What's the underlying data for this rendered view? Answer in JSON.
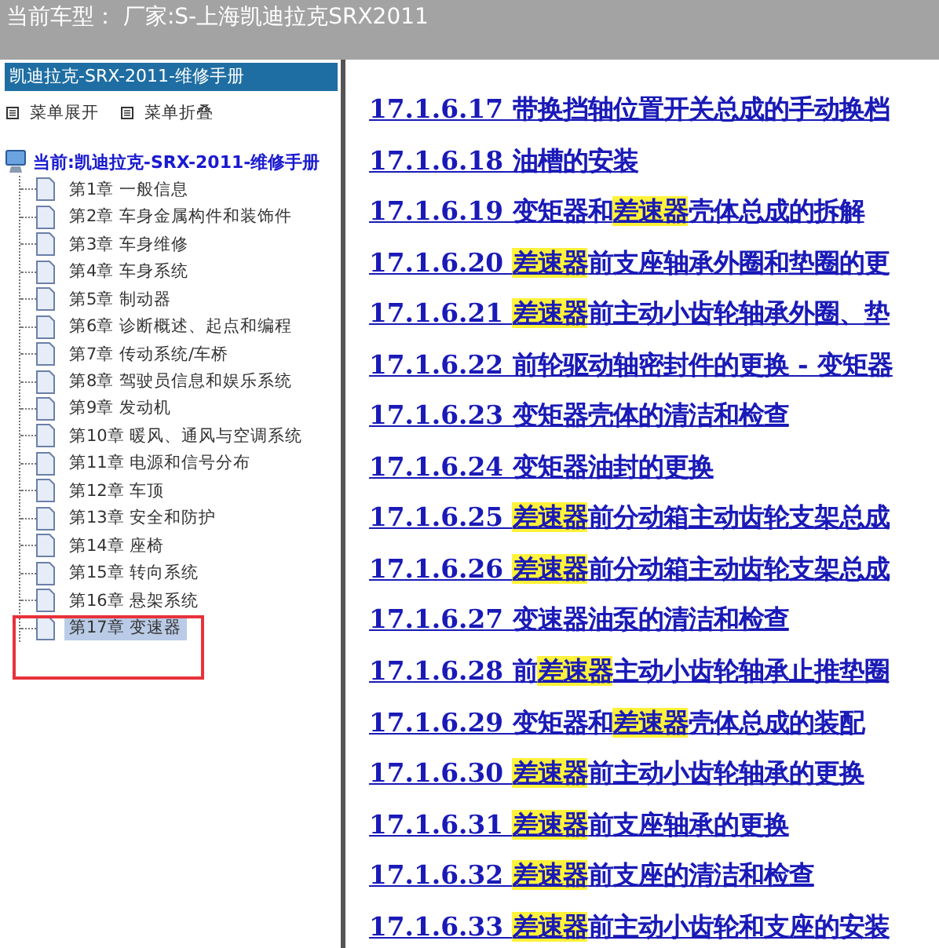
{
  "top_bar": {
    "title": "当前车型： 厂家:S-上海凯迪拉克SRX2011"
  },
  "sidebar": {
    "header": "凯迪拉克-SRX-2011-维修手册",
    "menu": [
      {
        "label": "菜单展开"
      },
      {
        "label": "菜单折叠"
      }
    ],
    "root": "当前:凯迪拉克-SRX-2011-维修手册",
    "items": [
      {
        "label": "第1章 一般信息",
        "selected": false
      },
      {
        "label": "第2章 车身金属构件和装饰件",
        "selected": false
      },
      {
        "label": "第3章 车身维修",
        "selected": false
      },
      {
        "label": "第4章 车身系统",
        "selected": false
      },
      {
        "label": "第5章 制动器",
        "selected": false
      },
      {
        "label": "第6章 诊断概述、起点和编程",
        "selected": false
      },
      {
        "label": "第7章 传动系统/车桥",
        "selected": false
      },
      {
        "label": "第8章 驾驶员信息和娱乐系统",
        "selected": false
      },
      {
        "label": "第9章 发动机",
        "selected": false
      },
      {
        "label": "第10章 暖风、通风与空调系统",
        "selected": false
      },
      {
        "label": "第11章 电源和信号分布",
        "selected": false
      },
      {
        "label": "第12章 车顶",
        "selected": false
      },
      {
        "label": "第13章 安全和防护",
        "selected": false
      },
      {
        "label": "第14章 座椅",
        "selected": false
      },
      {
        "label": "第15章 转向系统",
        "selected": false
      },
      {
        "label": "第16章 悬架系统",
        "selected": false
      },
      {
        "label": "第17章 变速器",
        "selected": true
      }
    ]
  },
  "links": [
    [
      {
        "text": "17.1.6.17 带换挡轴位置开关总成的手动换档"
      }
    ],
    [
      {
        "text": "17.1.6.18 油槽的安装"
      }
    ],
    [
      {
        "text": "17.1.6.19 变矩器和"
      },
      {
        "text": "差速器",
        "highlight": true
      },
      {
        "text": "壳体总成的拆解"
      }
    ],
    [
      {
        "text": "17.1.6.20 "
      },
      {
        "text": "差速器",
        "highlight": true
      },
      {
        "text": "前支座轴承外圈和垫圈的更"
      }
    ],
    [
      {
        "text": "17.1.6.21 "
      },
      {
        "text": "差速器",
        "highlight": true
      },
      {
        "text": "前主动小齿轮轴承外圈、垫"
      }
    ],
    [
      {
        "text": "17.1.6.22 前轮驱动轴密封件的更换 - 变矩器"
      }
    ],
    [
      {
        "text": "17.1.6.23 变矩器壳体的清洁和检查"
      }
    ],
    [
      {
        "text": "17.1.6.24 变矩器油封的更换"
      }
    ],
    [
      {
        "text": "17.1.6.25 "
      },
      {
        "text": "差速器",
        "highlight": true
      },
      {
        "text": "前分动箱主动齿轮支架总成"
      }
    ],
    [
      {
        "text": "17.1.6.26 "
      },
      {
        "text": "差速器",
        "highlight": true
      },
      {
        "text": "前分动箱主动齿轮支架总成"
      }
    ],
    [
      {
        "text": "17.1.6.27 变速器油泵的清洁和检查"
      }
    ],
    [
      {
        "text": "17.1.6.28 前"
      },
      {
        "text": "差速器",
        "highlight": true
      },
      {
        "text": "主动小齿轮轴承止推垫圈"
      }
    ],
    [
      {
        "text": "17.1.6.29 变矩器和"
      },
      {
        "text": "差速器",
        "highlight": true
      },
      {
        "text": "壳体总成的装配"
      }
    ],
    [
      {
        "text": "17.1.6.30 "
      },
      {
        "text": "差速器",
        "highlight": true
      },
      {
        "text": "前主动小齿轮轴承的更换"
      }
    ],
    [
      {
        "text": "17.1.6.31 "
      },
      {
        "text": "差速器",
        "highlight": true
      },
      {
        "text": "前支座轴承的更换"
      }
    ],
    [
      {
        "text": "17.1.6.32 "
      },
      {
        "text": "差速器",
        "highlight": true
      },
      {
        "text": "前支座的清洁和检查"
      }
    ],
    [
      {
        "text": "17.1.6.33 "
      },
      {
        "text": "差速器",
        "highlight": true
      },
      {
        "text": "前主动小齿轮和支座的安装"
      }
    ]
  ]
}
